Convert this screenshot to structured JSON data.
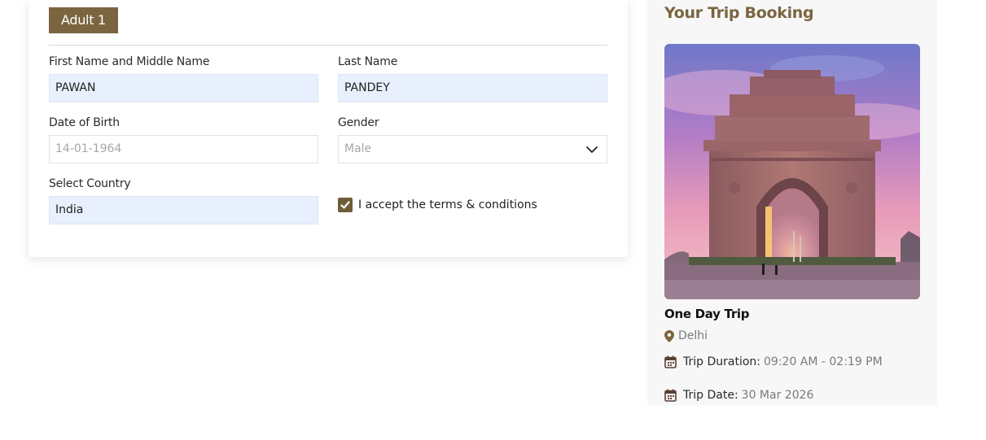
{
  "traveller": {
    "badge": "Adult 1",
    "first_name": {
      "label": "First Name and Middle Name",
      "value": "PAWAN"
    },
    "last_name": {
      "label": "Last Name",
      "value": "PANDEY"
    },
    "dob": {
      "label": "Date of Birth",
      "placeholder": "14-01-1964"
    },
    "gender": {
      "label": "Gender",
      "selected": "Male"
    },
    "country": {
      "label": "Select Country",
      "value": "India"
    },
    "terms": {
      "checked": true,
      "label": "I accept the terms & conditions"
    }
  },
  "booking": {
    "title": "Your Trip Booking",
    "trip_name": "One Day Trip",
    "location": "Delhi",
    "duration": {
      "key": "Trip Duration:",
      "value": "09:20 AM - 02:19 PM"
    },
    "date": {
      "key": "Trip Date:",
      "value": "30 Mar 2026"
    }
  },
  "colors": {
    "accent": "#7a6540",
    "checkbox": "#6f5d3a",
    "autofill": "#e8f0fe",
    "sidebar_bg": "#f7f7f7"
  },
  "icons": {
    "location": "map-pin-icon",
    "calendar": "calendar-icon",
    "dropdown": "chevron-down-icon",
    "check": "checkmark-icon"
  }
}
